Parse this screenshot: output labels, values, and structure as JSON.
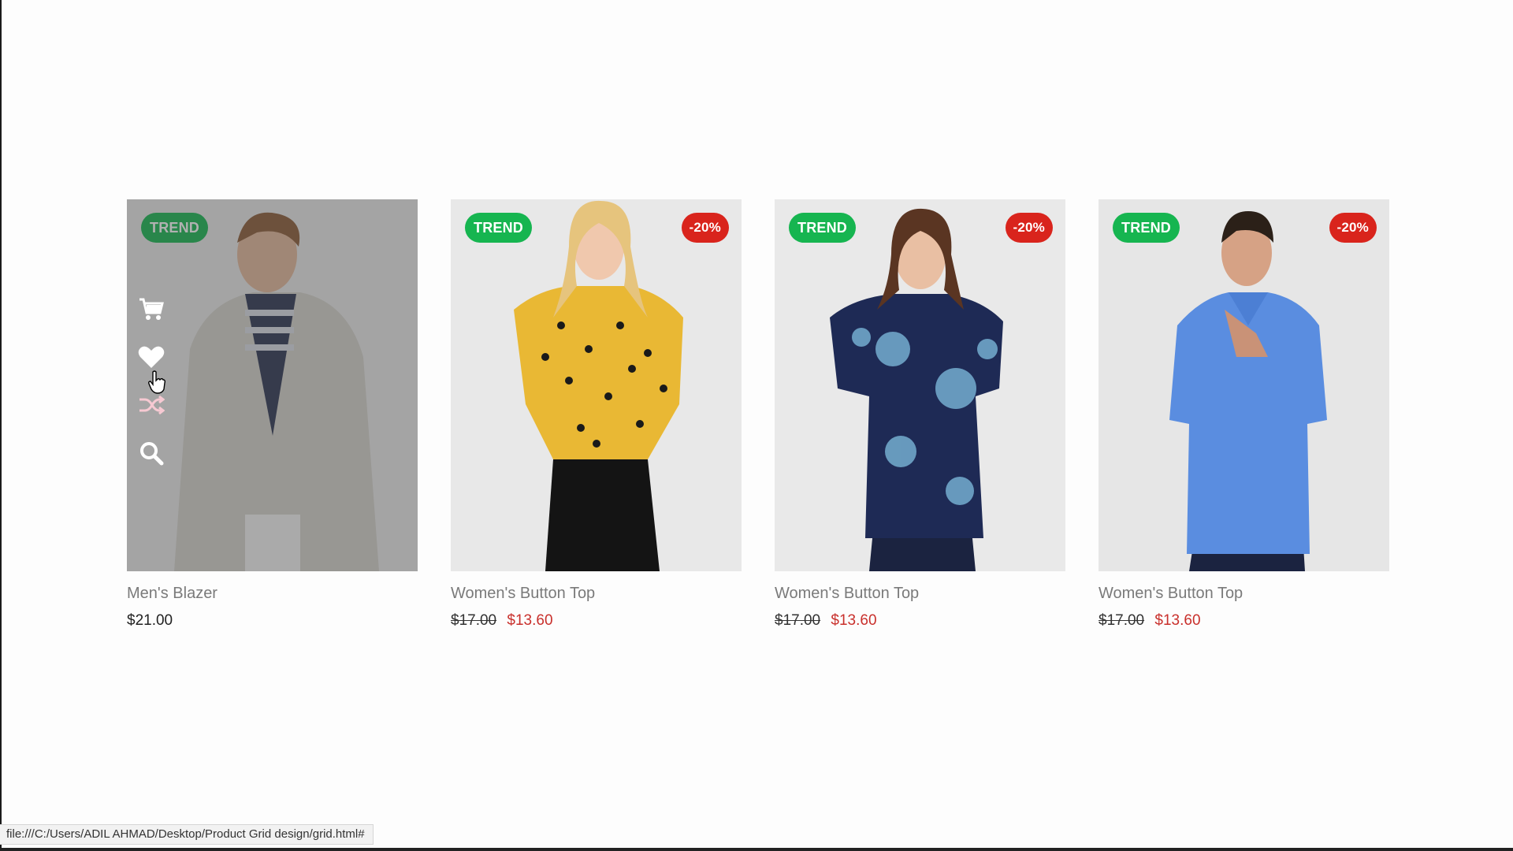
{
  "products": [
    {
      "name": "Men's Blazer",
      "badge_left": "TREND",
      "badge_right": "",
      "price": "$21.00",
      "old_price": "",
      "new_price": ""
    },
    {
      "name": "Women's Button Top",
      "badge_left": "TREND",
      "badge_right": "-20%",
      "price": "",
      "old_price": "$17.00",
      "new_price": "$13.60"
    },
    {
      "name": "Women's Button Top",
      "badge_left": "TREND",
      "badge_right": "-20%",
      "price": "",
      "old_price": "$17.00",
      "new_price": "$13.60"
    },
    {
      "name": "Women's Button Top",
      "badge_left": "TREND",
      "badge_right": "-20%",
      "price": "",
      "old_price": "$17.00",
      "new_price": "$13.60"
    }
  ],
  "hover_actions": [
    {
      "icon": "cart-icon"
    },
    {
      "icon": "heart-icon"
    },
    {
      "icon": "shuffle-icon"
    },
    {
      "icon": "search-icon"
    }
  ],
  "status_bar": {
    "url": "file:///C:/Users/ADIL AHMAD/Desktop/Product Grid design/grid.html#"
  },
  "colors": {
    "trend": "#16b550",
    "sale": "#d9241c",
    "new_price": "#c9302c"
  }
}
